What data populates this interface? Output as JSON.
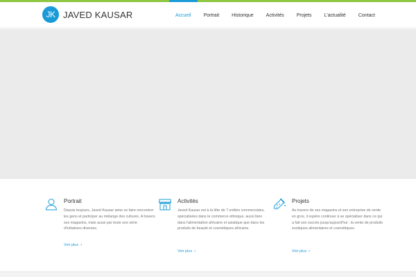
{
  "header": {
    "logo_initials": "JK",
    "logo_text": "JAVED KAUSAR",
    "nav": [
      {
        "label": "Accueil",
        "active": true
      },
      {
        "label": "Portrait",
        "active": false
      },
      {
        "label": "Historique",
        "active": false
      },
      {
        "label": "Activités",
        "active": false
      },
      {
        "label": "Projets",
        "active": false
      },
      {
        "label": "L'actualité",
        "active": false
      },
      {
        "label": "Contact",
        "active": false
      }
    ]
  },
  "features": [
    {
      "icon": "user-icon",
      "title": "Portrait",
      "body": "Depuis toujours, Javed Kausar aime se faire rencontrer les gens et participer au mélange des cultures. A travers ses magasins, mais aussi par toute une série d'initiatives diverses.",
      "more": "Voir plus"
    },
    {
      "icon": "store-icon",
      "title": "Activités",
      "body": "Javed Kausar est à la tête de 7 entités commerciales, spécialisées dans le commerce ethnique, aussi bien dans l'alimentation africaine et asiatique que dans les produits de beauté et cosmétiques africains.",
      "more": "Voir plus"
    },
    {
      "icon": "flask-icon",
      "title": "Projets",
      "body": "Au travers de ses magasins et son entreprise de vente en gros, il espère continuer à se spécialiser dans ce qui a fait son succès jusqu'aujourd'hui : la vente de produits exotiques alimentaires et cosmétiques.",
      "more": "Voir plus"
    }
  ],
  "colors": {
    "accent": "#1a9bd7",
    "top_bar": "#8dc63f",
    "hero_bg": "#ebebeb"
  }
}
